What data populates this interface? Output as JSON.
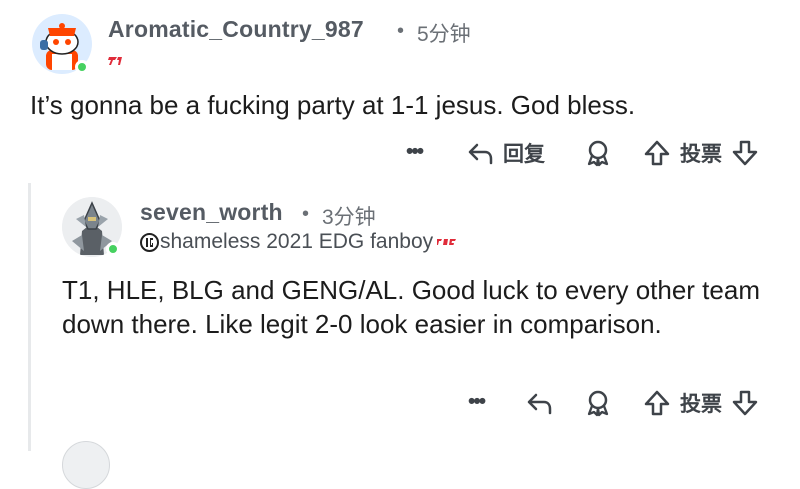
{
  "comments": [
    {
      "username": "Aromatic_Country_987",
      "separator": "•",
      "time": "5分钟",
      "flair": "",
      "body": "It’s gonna be a fucking party at 1-1 jesus. God bless.",
      "actions": {
        "more": "•••",
        "reply": "回复",
        "vote": "投票"
      }
    },
    {
      "username": "seven_worth",
      "separator": "•",
      "time": "3分钟",
      "flair": "shameless 2021 EDG fanboy",
      "body": "T1, HLE, BLG and GENG/AL. Good luck to every other team down there. Like legit 2-0 look easier in comparison.",
      "actions": {
        "more": "•••",
        "vote": "投票"
      }
    }
  ],
  "colors": {
    "online": "#46d160",
    "flair_red": "#e02c3a",
    "text": "#1c1c1c",
    "meta": "#6b7076"
  }
}
